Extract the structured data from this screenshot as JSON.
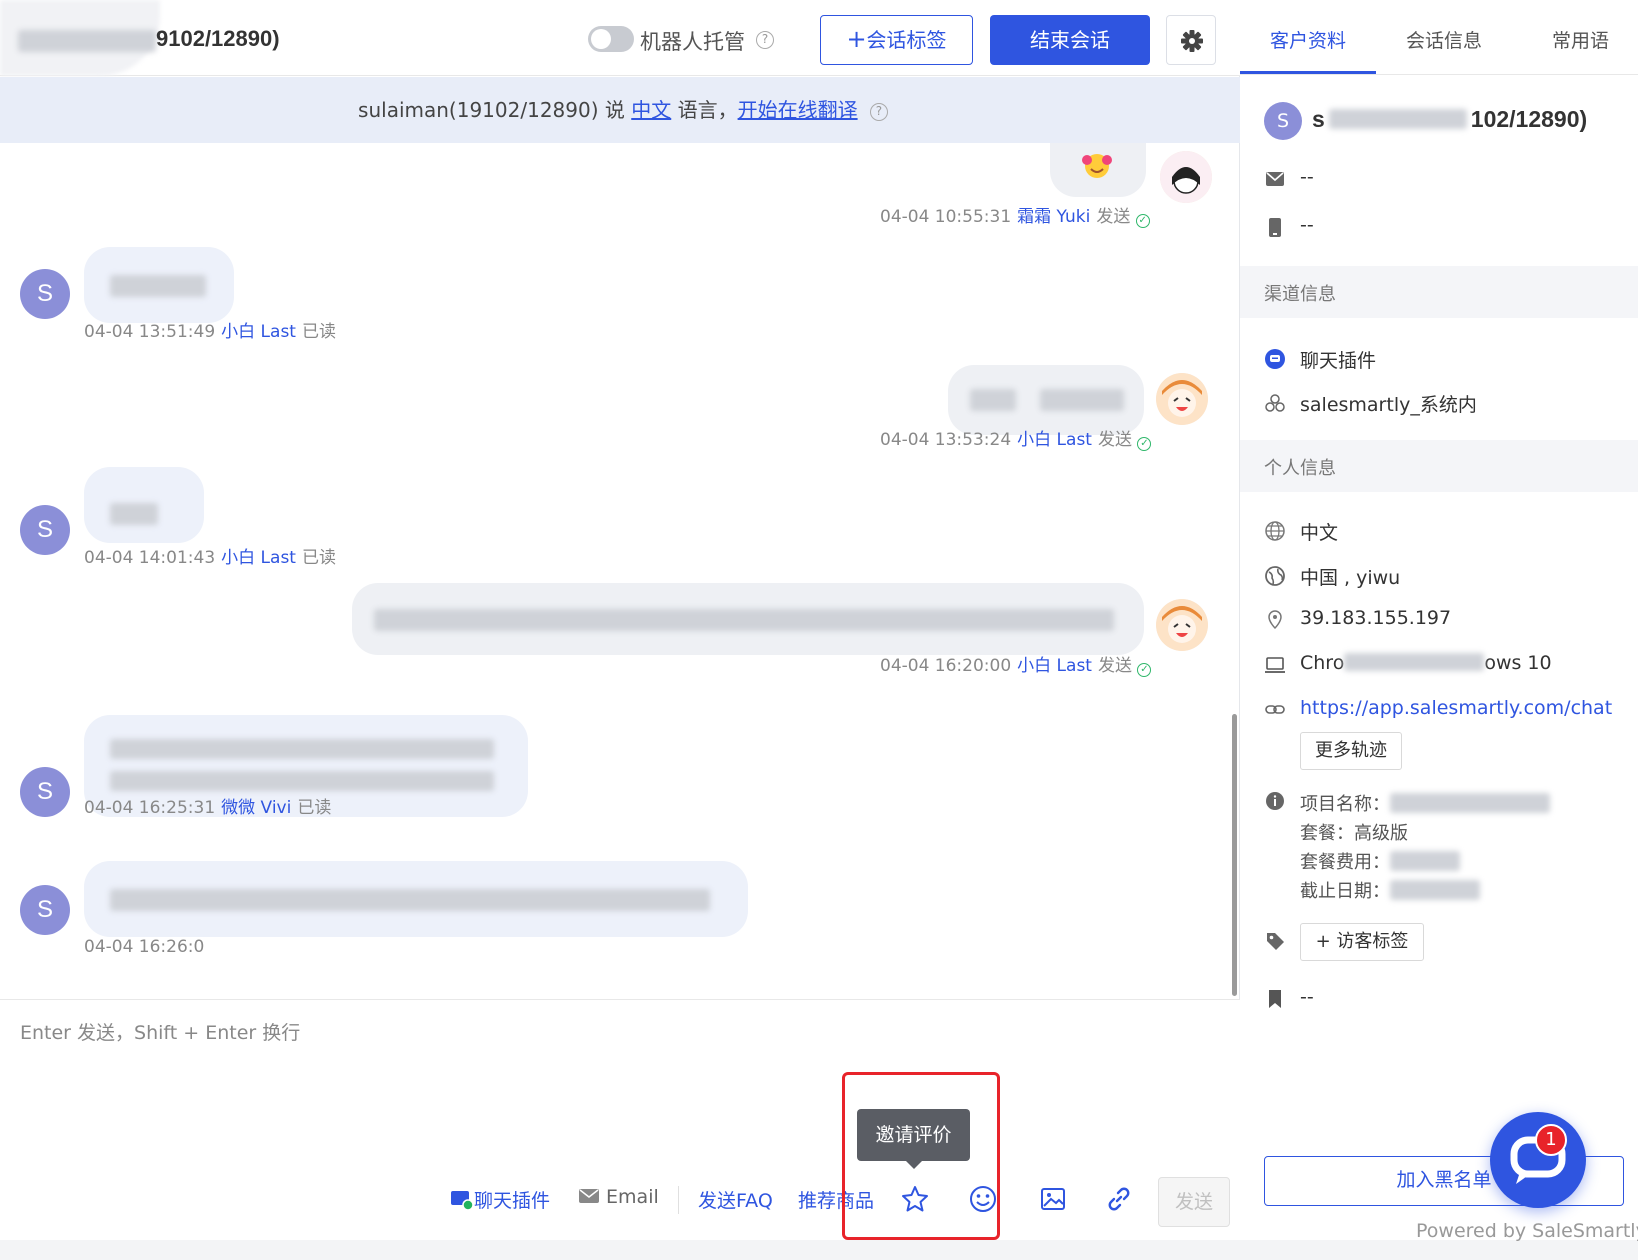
{
  "header": {
    "title_visible": "9102/12890)",
    "robot_label": "机器人托管",
    "tag_button": "会话标签",
    "tag_plus": "+",
    "end_button": "结束会话"
  },
  "translate_bar": {
    "prefix": "sulaiman(19102/12890) 说 ",
    "language": "中文",
    "middle": " 语言，",
    "action": "开始在线翻译"
  },
  "messages": [
    {
      "dir": "out",
      "time": "04-04 10:55:31",
      "agent": "霜霜 Yuki",
      "status": "发送"
    },
    {
      "dir": "in",
      "time": "04-04 13:51:49",
      "agent": "小白 Last",
      "status": "已读"
    },
    {
      "dir": "out",
      "time": "04-04 13:53:24",
      "agent": "小白 Last",
      "status": "发送"
    },
    {
      "dir": "in",
      "time": "04-04 14:01:43",
      "agent": "小白 Last",
      "status": "已读"
    },
    {
      "dir": "out",
      "time": "04-04 16:20:00",
      "agent": "小白 Last",
      "status": "发送"
    },
    {
      "dir": "in",
      "time": "04-04 16:25:31",
      "agent": "微微 Vivi",
      "status": "已读"
    },
    {
      "dir": "in",
      "time": "04-04 16:26:0",
      "agent": "",
      "status": ""
    }
  ],
  "avatar_letter": "S",
  "composer": {
    "placeholder": "Enter 发送，Shift + Enter 换行",
    "chat_plugin": "聊天插件",
    "email": "Email",
    "send_faq": "发送FAQ",
    "recommend": "推荐商品",
    "send": "发送",
    "tooltip": "邀请评价"
  },
  "side": {
    "tabs": [
      "客户资料",
      "会话信息",
      "常用语"
    ],
    "avatar_letter": "S",
    "name_prefix": "s",
    "name_visible": "102/12890)",
    "email": "--",
    "phone": "--",
    "channel_section": "渠道信息",
    "channel_plugin": "聊天插件",
    "channel_site": "salesmartly_系统内",
    "personal_section": "个人信息",
    "language": "中文",
    "location": "中国 , yiwu",
    "ip": "39.183.155.197",
    "browser_start": "Chro",
    "browser_end": "ows 10",
    "url": "https://app.salesmartly.com/chat",
    "more_track": "更多轨迹",
    "project_label": "项目名称：",
    "plan_label": "套餐：高级版",
    "plan_fee_label": "套餐费用：",
    "deadline_label": "截止日期：",
    "visitor_tag": "+ 访客标签",
    "bookmark": "--",
    "blacklist": "加入黑名单"
  },
  "fab_badge": "1",
  "powered_by": "Powered by SaleSmartly",
  "colors": {
    "primary": "#2f55e0",
    "bubble_in": "#edf1fa",
    "avatar": "#8b8fd8",
    "highlight": "#e8232a"
  }
}
